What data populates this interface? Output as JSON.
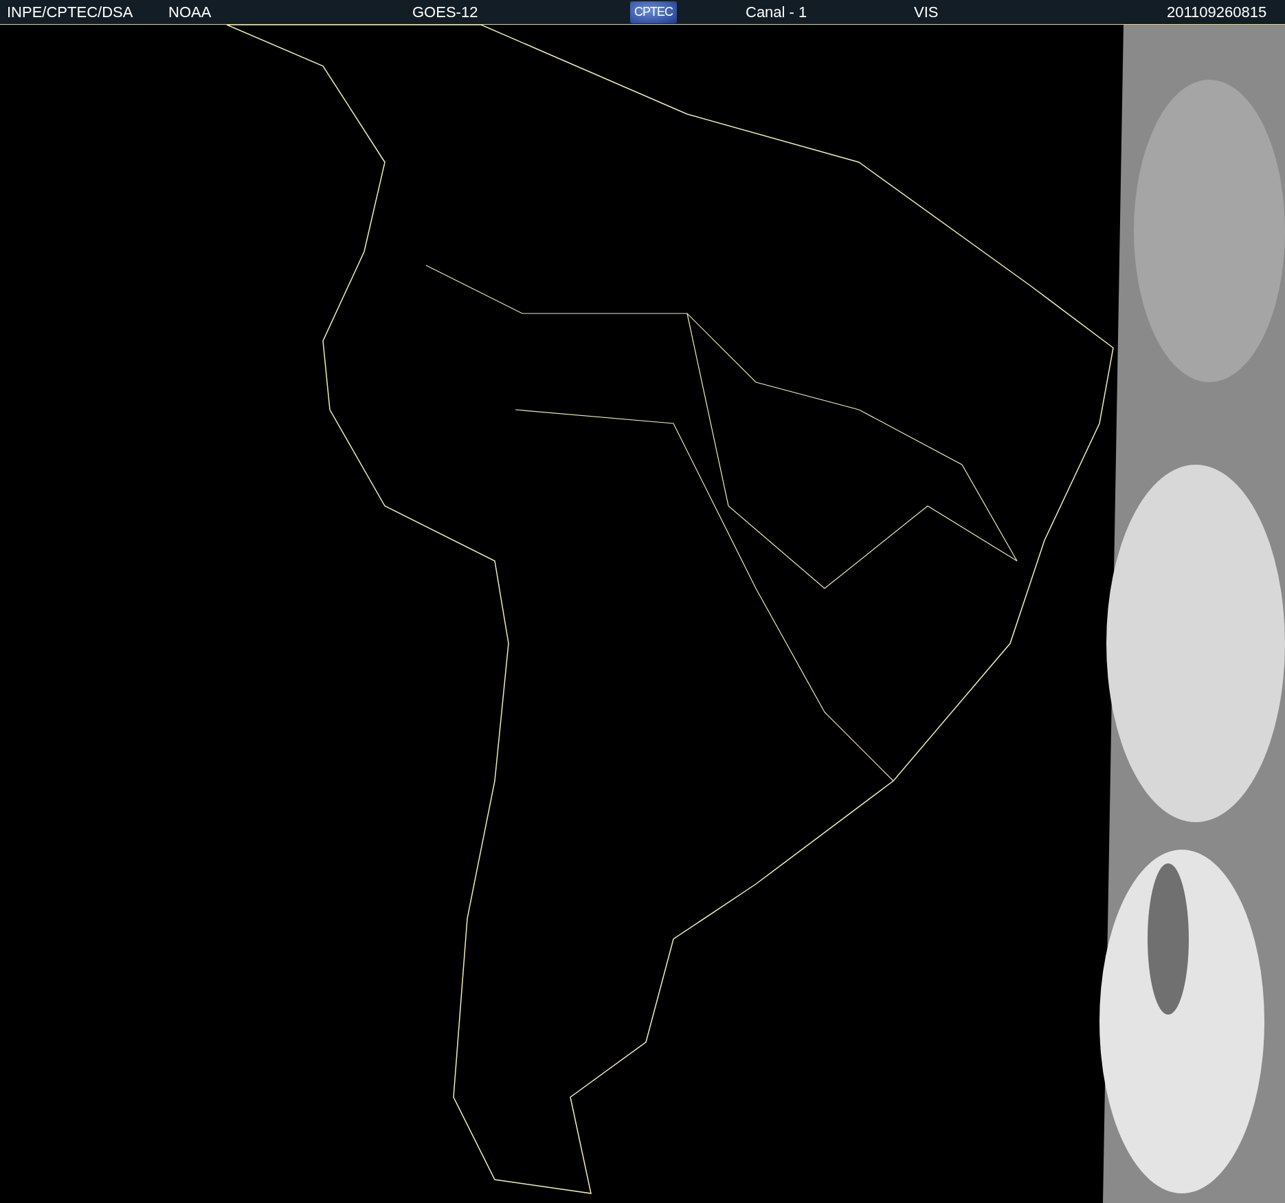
{
  "header": {
    "labels": [
      {
        "text": "INPE/CPTEC/DSA"
      },
      {
        "text": "NOAA"
      },
      {
        "text": "GOES-12"
      }
    ],
    "logo": {
      "text": "CPTEC"
    },
    "labels_right": [
      {
        "text": "Canal - 1"
      },
      {
        "text": "VIS"
      },
      {
        "text": "201109260815"
      }
    ]
  }
}
